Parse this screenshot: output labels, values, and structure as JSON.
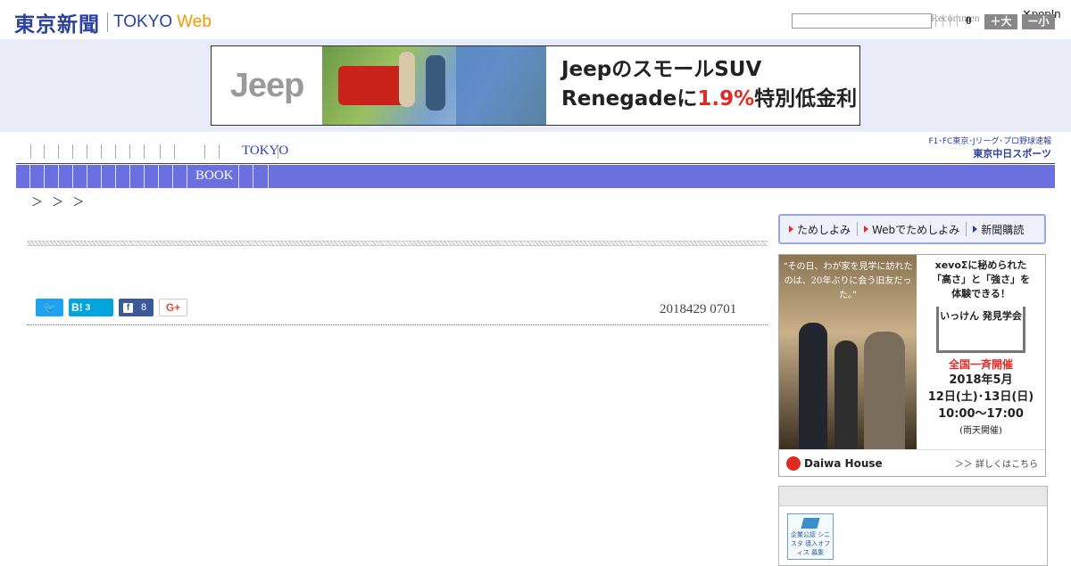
{
  "header": {
    "logo_jp": "東京新聞",
    "logo_en": "TOKYO",
    "logo_web": "Web",
    "search_placeholder": "",
    "recommend_label": "Recommen",
    "popin_label": "✕popIn",
    "count": "0",
    "font_larger": "＋大",
    "font_smaller": "ー小"
  },
  "ad": {
    "brand": "Jeep",
    "line1": "Jeep",
    "line1b": "のスモールSUV",
    "line2a": "Renegadeに",
    "line2b": "1.9%",
    "line2c": "特別低金利"
  },
  "nav": {
    "tokyo": "TOKYO",
    "book": "BOOK",
    "chunichi_top": "F1･FC東京･Jリーグ･プロ野球速報",
    "chunichi_brand": "東京中日スポーツ",
    "breadcrumb": "＞ ＞ ＞"
  },
  "article": {
    "hatena_count": "3",
    "facebook_count": "8",
    "date": "2018429 0701"
  },
  "subscribe": {
    "item1": "ためしよみ",
    "item2": "Webでためしよみ",
    "item3": "新聞購読"
  },
  "daiwa_ad": {
    "quote": "“その日、わが家を見学に訪れたのは、20年ぶりに会う旧友だった。”",
    "head1": "xevoΣに秘められた",
    "head2": "「高さ」と「強さ」を",
    "head3": "体験できる！",
    "event": "いっけん 発見学会",
    "nationwide": "全国一斉開催",
    "date1": "2018年5月",
    "date2": "12日(土)･13日(日)",
    "time": "10:00〜17:00",
    "rain": "(雨天開催)",
    "brand": "Daiwa House",
    "more": "＞＞ 詳しくはこちら"
  },
  "badge": {
    "text": "企業公認 シニスタ 導入オフィス 募集"
  },
  "colors": {
    "brand_blue": "#2a3f9e",
    "nav_band": "#6c6fe0",
    "web_orange": "#f39800",
    "accent_red": "#e02a24"
  }
}
